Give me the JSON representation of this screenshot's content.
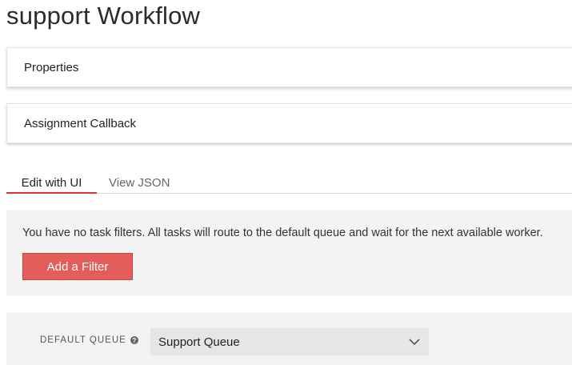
{
  "page": {
    "title": "support Workflow"
  },
  "panels": {
    "properties": "Properties",
    "assignment_callback": "Assignment Callback"
  },
  "tabs": {
    "edit_ui": "Edit with UI",
    "view_json": "View JSON",
    "active": "Edit with UI"
  },
  "filters": {
    "message": "You have no task filters. All tasks will route to the default queue and wait for the next available worker.",
    "add_button": "Add a Filter"
  },
  "default_queue": {
    "label": "DEFAULT QUEUE",
    "help_icon": "question-circle-icon",
    "selected": "Support Queue",
    "dropdown_icon": "chevron-down-icon"
  },
  "colors": {
    "accent": "#e0333a",
    "button": "#e35d5b",
    "panel_bg": "#f3f3f3"
  }
}
